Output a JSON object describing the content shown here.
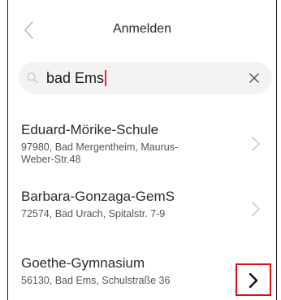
{
  "header": {
    "title": "Anmelden",
    "back_icon": "chevron-left-icon"
  },
  "search": {
    "value": "bad Ems",
    "icon": "search-icon",
    "clear_icon": "close-icon"
  },
  "schools": [
    {
      "name": "Eduard-Mörike-Schule",
      "address": "97980, Bad Mergentheim, Maurus-Weber-Str.48"
    },
    {
      "name": "Barbara-Gonzaga-GemS",
      "address": "72574, Bad Urach, Spitalstr. 7-9"
    },
    {
      "name": "Goethe-Gymnasium",
      "address": "56130, Bad Ems, Schulstraße 36"
    }
  ],
  "colors": {
    "highlight": "#e01010",
    "caret": "#e03030",
    "search_bg": "#f3f3f3"
  }
}
